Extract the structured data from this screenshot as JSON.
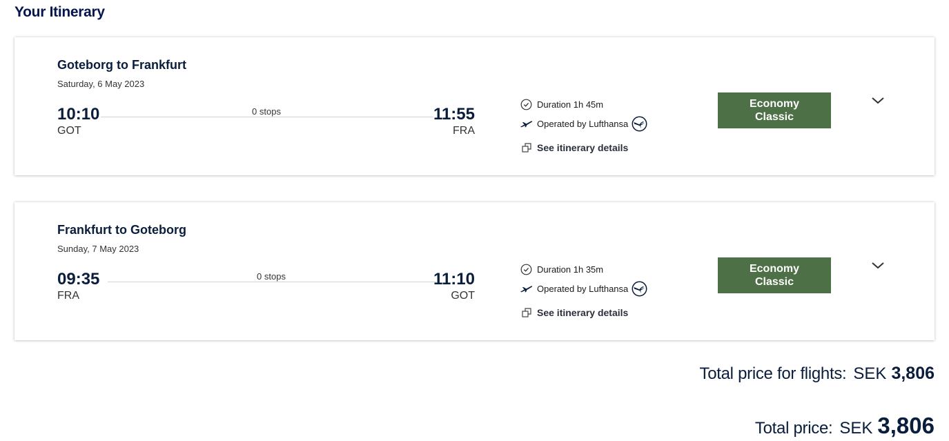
{
  "page_title": "Your Itinerary",
  "flights": [
    {
      "route": "Goteborg to Frankfurt",
      "date": "Saturday, 6 May 2023",
      "departure": {
        "time": "10:10",
        "code": "GOT"
      },
      "arrival": {
        "time": "11:55",
        "code": "FRA"
      },
      "stops": "0 stops",
      "duration": "Duration 1h 45m",
      "operated_by": "Operated by Lufthansa",
      "details_link": "See itinerary details",
      "fare": {
        "line1": "Economy",
        "line2": "Classic"
      }
    },
    {
      "route": "Frankfurt to Goteborg",
      "date": "Sunday, 7 May 2023",
      "departure": {
        "time": "09:35",
        "code": "FRA"
      },
      "arrival": {
        "time": "11:10",
        "code": "GOT"
      },
      "stops": "0 stops",
      "duration": "Duration 1h 35m",
      "operated_by": "Operated by Lufthansa",
      "details_link": "See itinerary details",
      "fare": {
        "line1": "Economy",
        "line2": "Classic"
      }
    }
  ],
  "totals": {
    "flights_label": "Total price for flights:",
    "flights_currency": "SEK",
    "flights_amount": "3,806",
    "total_label": "Total price:",
    "total_currency": "SEK",
    "total_amount": "3,806"
  },
  "colors": {
    "fare_button": "#4e7046",
    "title": "#05164d"
  }
}
